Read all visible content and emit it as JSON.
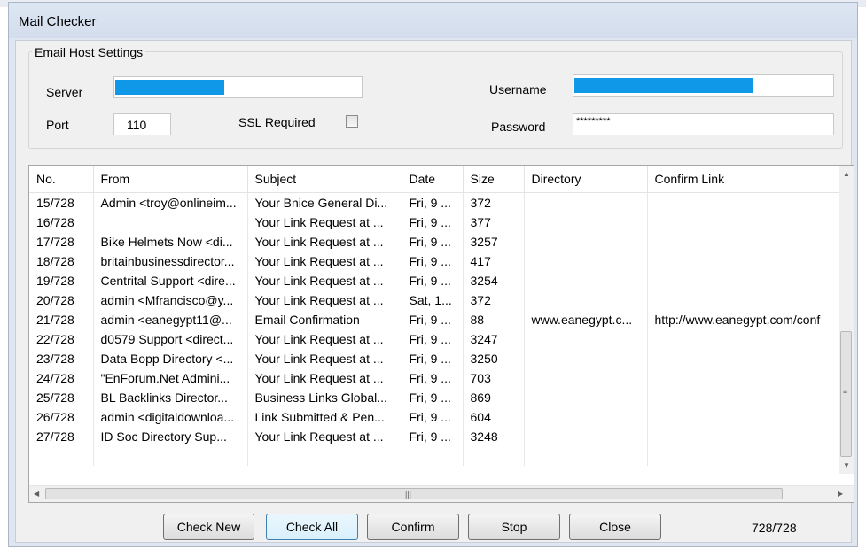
{
  "window": {
    "title": "Mail Checker"
  },
  "settings": {
    "legend": "Email Host Settings",
    "server_label": "Server",
    "port_label": "Port",
    "port_value": "110",
    "ssl_label": "SSL Required",
    "ssl_checked": false,
    "username_label": "Username",
    "password_label": "Password",
    "password_value": "*********"
  },
  "grid": {
    "columns": [
      "No.",
      "From",
      "Subject",
      "Date",
      "Size",
      "Directory",
      "Confirm Link"
    ],
    "rows": [
      [
        "15/728",
        "Admin <troy@onlineim...",
        "Your Bnice General Di...",
        "Fri, 9 ...",
        "372",
        "",
        ""
      ],
      [
        "16/728",
        "",
        "Your Link Request at ...",
        "Fri, 9 ...",
        "377",
        "",
        ""
      ],
      [
        "17/728",
        "Bike Helmets Now <di...",
        "Your Link Request at ...",
        "Fri, 9 ...",
        "3257",
        "",
        ""
      ],
      [
        "18/728",
        "britainbusinessdirector...",
        "Your Link Request at ...",
        "Fri, 9 ...",
        "417",
        "",
        ""
      ],
      [
        "19/728",
        "Centrital Support <dire...",
        "Your Link Request at ...",
        "Fri, 9 ...",
        "3254",
        "",
        ""
      ],
      [
        "20/728",
        "admin <Mfrancisco@y...",
        "Your Link Request at ...",
        "Sat, 1...",
        "372",
        "",
        ""
      ],
      [
        "21/728",
        "admin <eanegypt11@...",
        "Email Confirmation",
        "Fri, 9 ...",
        "88",
        "www.eanegypt.c...",
        "http://www.eanegypt.com/conf"
      ],
      [
        "22/728",
        "d0579 Support <direct...",
        "Your Link Request at ...",
        "Fri, 9 ...",
        "3247",
        "",
        ""
      ],
      [
        "23/728",
        "Data Bopp Directory <...",
        "Your Link Request at ...",
        "Fri, 9 ...",
        "3250",
        "",
        ""
      ],
      [
        "24/728",
        "\"EnForum.Net Admini...",
        "Your Link Request at ...",
        "Fri, 9 ...",
        "703",
        "",
        ""
      ],
      [
        "25/728",
        "BL Backlinks Director...",
        "Business Links Global...",
        "Fri, 9 ...",
        "869",
        "",
        ""
      ],
      [
        "26/728",
        "admin <digitaldownloa...",
        "Link Submitted & Pen...",
        "Fri, 9 ...",
        "604",
        "",
        ""
      ],
      [
        "27/728",
        "ID Soc Directory Sup...",
        "Your Link Request at ...",
        "Fri, 9 ...",
        "3248",
        "",
        ""
      ]
    ]
  },
  "buttons": {
    "check_new": "Check New",
    "check_all": "Check All",
    "confirm": "Confirm",
    "stop": "Stop",
    "close": "Close"
  },
  "status": {
    "counter": "728/728"
  },
  "colors": {
    "redaction_bar": "#0f97e8"
  }
}
